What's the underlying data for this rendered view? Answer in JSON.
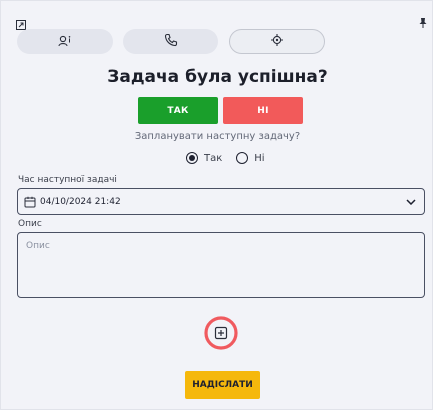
{
  "toolbar": {
    "expand_icon": "expand-icon",
    "pin_icon": "pin-icon",
    "buttons": [
      {
        "icon": "agent-info-icon"
      },
      {
        "icon": "phone-icon"
      },
      {
        "icon": "target-icon",
        "active": true
      }
    ]
  },
  "form": {
    "title": "Задача була успішна?",
    "yes_label": "ТАК",
    "no_label": "НІ",
    "schedule_question": "Запланувати наступну задачу?",
    "radio_yes_label": "Так",
    "radio_no_label": "Ні",
    "radio_selected": "Так",
    "next_task_time_label": "Час наступної задачі",
    "next_task_time_value": "04/10/2024 21:42",
    "description_label": "Опис",
    "description_placeholder": "Опис",
    "submit_label": "НАДІСЛАТИ"
  },
  "colors": {
    "yes": "#1a9f2b",
    "no": "#f25a5a",
    "submit": "#f5b80c",
    "attach_ring": "#f05a5f"
  }
}
